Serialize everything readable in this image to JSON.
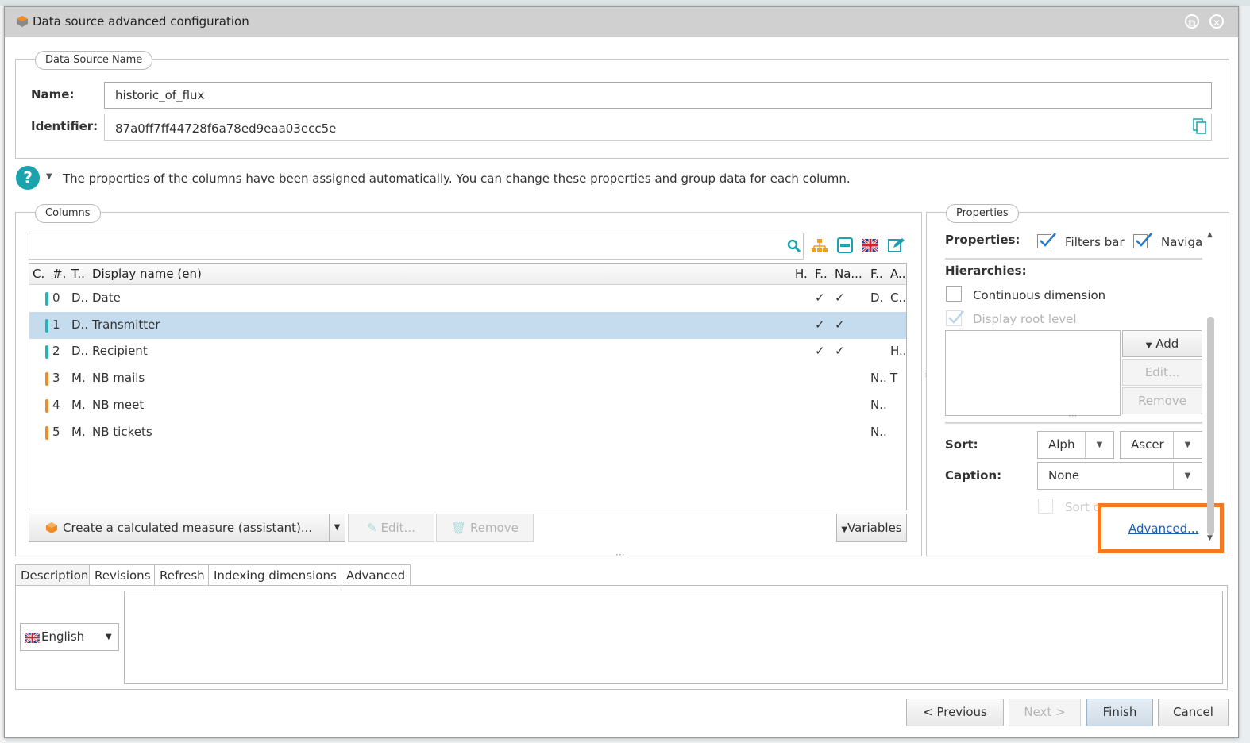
{
  "dialog": {
    "title": "Data source advanced configuration",
    "restore_icon": "⧉",
    "close_icon": "✕"
  },
  "datasource": {
    "legend": "Data Source Name",
    "name_label": "Name:",
    "name_value": "historic_of_flux",
    "identifier_label": "Identifier:",
    "identifier_value": "87a0ff7ff44728f6a78ed9eaa03ecc5e"
  },
  "help": {
    "icon": "?",
    "text": "The properties of the columns have been assigned automatically. You can change these properties and group data for each column."
  },
  "columns": {
    "legend": "Columns",
    "search_value": "",
    "headers": [
      "C.",
      "#.",
      "T..",
      "Display name (en)",
      "H.",
      "F..",
      "Na...",
      "F..",
      "A.."
    ],
    "rows": [
      {
        "num": "0",
        "type": "D..",
        "name": "Date",
        "h": "",
        "f": "✓",
        "na": "✓",
        "f2": "D.",
        "a": "C..",
        "color": "#26b3b8"
      },
      {
        "num": "1",
        "type": "D..",
        "name": "Transmitter",
        "h": "",
        "f": "✓",
        "na": "✓",
        "f2": "",
        "a": "",
        "color": "#26b3b8"
      },
      {
        "num": "2",
        "type": "D..",
        "name": "Recipient",
        "h": "",
        "f": "✓",
        "na": "✓",
        "f2": "",
        "a": "H..",
        "color": "#26b3b8"
      },
      {
        "num": "3",
        "type": "M.",
        "name": "NB mails",
        "h": "",
        "f": "",
        "na": "",
        "f2": "N..",
        "a": "T",
        "color": "#f08a24"
      },
      {
        "num": "4",
        "type": "M.",
        "name": "NB meet",
        "h": "",
        "f": "",
        "na": "",
        "f2": "N..",
        "a": "",
        "color": "#f08a24"
      },
      {
        "num": "5",
        "type": "M.",
        "name": "NB tickets",
        "h": "",
        "f": "",
        "na": "",
        "f2": "N..",
        "a": "",
        "color": "#f08a24"
      }
    ],
    "create_measure_label": "Create a calculated measure (assistant)...",
    "edit_label": "Edit...",
    "remove_label": "Remove",
    "variables_label": "Variables"
  },
  "properties": {
    "legend": "Properties",
    "properties_label": "Properties:",
    "filters_bar_label": "Filters bar",
    "navigation_label": "Naviga",
    "hierarchies_label": "Hierarchies:",
    "continuous_label": "Continuous dimension",
    "display_root_label": "Display root level",
    "add_label": "Add",
    "edit_label": "Edit...",
    "remove_label": "Remove",
    "sort_label": "Sort:",
    "sort_value1": "Alph",
    "sort_value2": "Ascer",
    "caption_label": "Caption:",
    "caption_value": "None",
    "sort_caption_label": "Sort c",
    "advanced_label": "Advanced..."
  },
  "bottom_tabs": {
    "tabs": [
      "Description",
      "Revisions",
      "Refresh",
      "Indexing dimensions",
      "Advanced"
    ],
    "language_value": "English",
    "description_value": ""
  },
  "footer": {
    "previous_label": "< Previous",
    "next_label": "Next >",
    "finish_label": "Finish",
    "cancel_label": "Cancel"
  },
  "colors": {
    "accent": "#1ba3ad",
    "dimension": "#26b3b8",
    "measure": "#f08a24",
    "highlight": "#f47920",
    "selection": "#c5dcef",
    "link": "#1a5fb4"
  }
}
